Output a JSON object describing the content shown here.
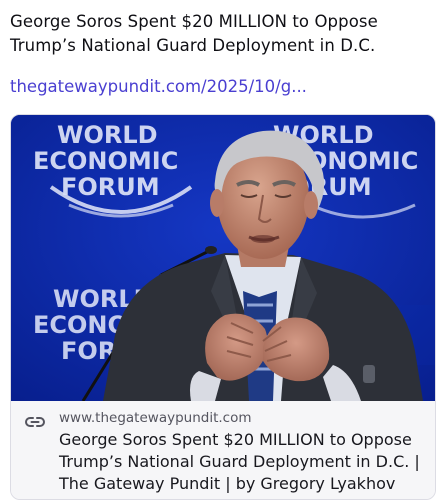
{
  "post": {
    "text": "George Soros Spent $20 MILLION to Oppose Trump’s National Guard Deployment in D.C.",
    "link_text": "thegatewaypundit.com/2025/10/g..."
  },
  "link_card": {
    "domain": "www.thegatewaypundit.com",
    "title": "George Soros Spent $20 MILLION to Oppose Trump’s National Guard Deployment in D.C. | The Gateway Pundit | by Gregory Lyakhov",
    "image_logo_text": {
      "left": [
        "WORLD",
        "ECONOMIC",
        "FORUM"
      ],
      "right": [
        "WORLD",
        "ECONOMIC",
        "FORUM"
      ],
      "bottom_left": [
        "WORLD",
        "ECONOMIC",
        "FORUM"
      ]
    }
  },
  "colors": {
    "link": "#4a3fd1",
    "image_background": "#0c2bb0"
  },
  "icons": {
    "card_link_icon": "link-icon"
  }
}
